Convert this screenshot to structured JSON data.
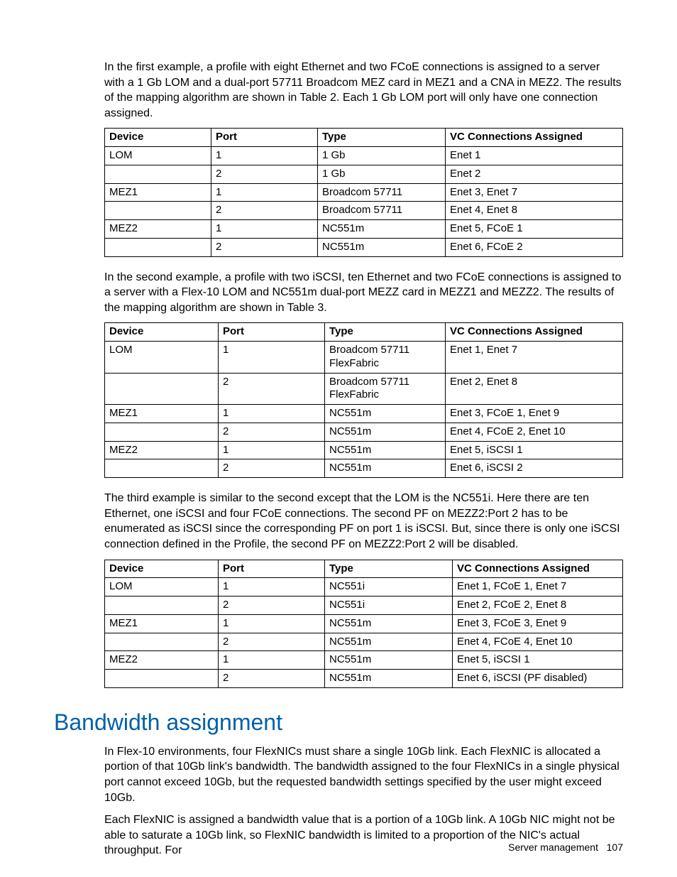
{
  "para1": "In the first example, a profile with eight Ethernet and two FCoE connections is assigned to a server with a 1 Gb LOM and a dual-port 57711 Broadcom MEZ card in MEZ1 and a CNA in MEZ2. The results of the mapping algorithm are shown in Table 2. Each 1 Gb LOM port will only have one connection assigned.",
  "table1": {
    "headers": {
      "c0": "Device",
      "c1": "Port",
      "c2": "Type",
      "c3": "VC Connections Assigned"
    },
    "rows": [
      {
        "c0": "LOM",
        "c1": "1",
        "c2": "1 Gb",
        "c3": "Enet 1"
      },
      {
        "c0": "",
        "c1": "2",
        "c2": "1 Gb",
        "c3": "Enet 2"
      },
      {
        "c0": "MEZ1",
        "c1": "1",
        "c2": "Broadcom 57711",
        "c3": "Enet 3, Enet 7"
      },
      {
        "c0": "",
        "c1": "2",
        "c2": "Broadcom 57711",
        "c3": "Enet 4, Enet 8"
      },
      {
        "c0": "MEZ2",
        "c1": "1",
        "c2": "NC551m",
        "c3": "Enet 5, FCoE 1"
      },
      {
        "c0": "",
        "c1": "2",
        "c2": "NC551m",
        "c3": "Enet 6, FCoE 2"
      }
    ]
  },
  "para2": "In the second example, a profile with two iSCSI, ten Ethernet and two FCoE connections is assigned to a server with a Flex-10 LOM and NC551m dual-port  MEZZ card in MEZZ1 and MEZZ2. The results of the mapping algorithm are shown in Table 3.",
  "table2": {
    "headers": {
      "c0": "Device",
      "c1": "Port",
      "c2": "Type",
      "c3": "VC Connections Assigned"
    },
    "rows": [
      {
        "c0": "LOM",
        "c1": "1",
        "c2": "Broadcom 57711 FlexFabric",
        "c3": "Enet 1, Enet 7"
      },
      {
        "c0": "",
        "c1": "2",
        "c2": "Broadcom 57711 FlexFabric",
        "c3": "Enet 2, Enet 8"
      },
      {
        "c0": "MEZ1",
        "c1": "1",
        "c2": "NC551m",
        "c3": "Enet 3, FCoE 1, Enet 9"
      },
      {
        "c0": "",
        "c1": "2",
        "c2": "NC551m",
        "c3": "Enet 4, FCoE 2, Enet 10"
      },
      {
        "c0": "MEZ2",
        "c1": "1",
        "c2": "NC551m",
        "c3": "Enet 5, iSCSI 1"
      },
      {
        "c0": "",
        "c1": "2",
        "c2": "NC551m",
        "c3": "Enet 6, iSCSI 2"
      }
    ]
  },
  "para3": "The third example is similar to the second except that the LOM is the NC551i. Here there are ten Ethernet, one iSCSI and four FCoE connections. The second PF on MEZZ2:Port 2 has to be enumerated as iSCSI since the corresponding PF on port 1 is iSCSI. But, since there is only one iSCSI connection defined in the Profile, the second PF on MEZZ2:Port 2 will be disabled.",
  "table3": {
    "headers": {
      "c0": "Device",
      "c1": "Port",
      "c2": "Type",
      "c3": "VC Connections Assigned"
    },
    "rows": [
      {
        "c0": "LOM",
        "c1": "1",
        "c2": "NC551i",
        "c3": "Enet 1, FCoE 1, Enet 7"
      },
      {
        "c0": "",
        "c1": "2",
        "c2": "NC551i",
        "c3": "Enet 2, FCoE 2, Enet 8"
      },
      {
        "c0": "MEZ1",
        "c1": "1",
        "c2": "NC551m",
        "c3": "Enet 3, FCoE 3, Enet 9"
      },
      {
        "c0": "",
        "c1": "2",
        "c2": "NC551m",
        "c3": "Enet 4, FCoE 4, Enet 10"
      },
      {
        "c0": "MEZ2",
        "c1": "1",
        "c2": "NC551m",
        "c3": "Enet 5, iSCSI 1"
      },
      {
        "c0": "",
        "c1": "2",
        "c2": "NC551m",
        "c3": "Enet 6, iSCSI (PF disabled)"
      }
    ]
  },
  "heading": "Bandwidth assignment",
  "para4": "In Flex-10 environments, four FlexNICs must share a single 10Gb link. Each FlexNIC is allocated a portion of that 10Gb link's bandwidth. The bandwidth assigned to the four FlexNICs in a single physical port cannot exceed 10Gb, but the requested bandwidth settings specified by the user might exceed 10Gb.",
  "para5": "Each FlexNIC is assigned a bandwidth value that is a portion of a 10Gb link. A 10Gb NIC might not be able to saturate a 10Gb link, so FlexNIC bandwidth is limited to a proportion of the NIC's actual throughput. For",
  "footer": {
    "label": "Server management",
    "page": "107"
  }
}
